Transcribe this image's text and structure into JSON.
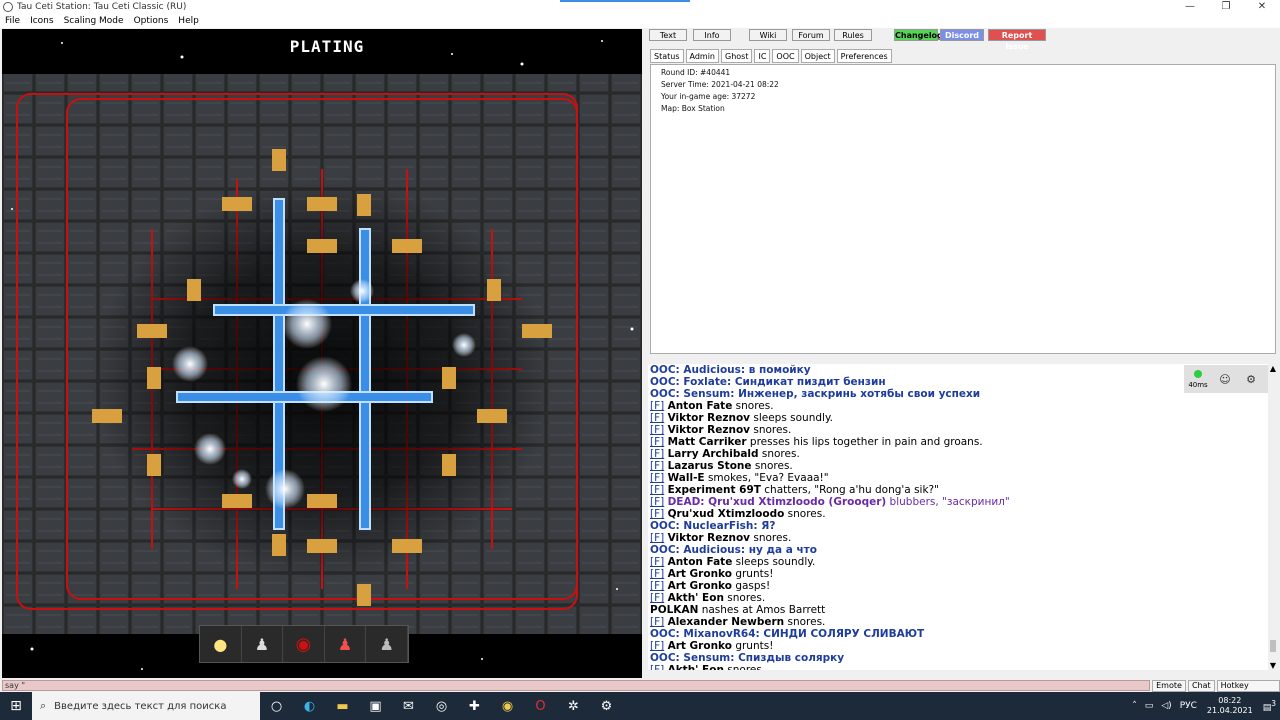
{
  "window": {
    "title": "Tau Ceti Station: Tau Ceti Classic (RU)",
    "controls": [
      "—",
      "❐",
      "✕"
    ]
  },
  "menu": [
    "File",
    "Icons",
    "Scaling Mode",
    "Options",
    "Help"
  ],
  "game": {
    "turf_name": "PLATING"
  },
  "top_buttons": {
    "text": "Text",
    "info": "Info",
    "wiki": "Wiki",
    "forum": "Forum",
    "rules": "Rules",
    "changelog": "Changelog",
    "discord": "Discord",
    "report": "Report Issue"
  },
  "tabs": [
    "Status",
    "Admin",
    "Ghost",
    "IC",
    "OOC",
    "Object",
    "Preferences"
  ],
  "status": [
    "Round ID: #40441",
    "Server Time: 2021-04-21 08:22",
    "Your in-game age: 37272",
    "Map: Box Station"
  ],
  "chat": [
    {
      "type": "ooc",
      "text": "OOC: Audicious: в помойку"
    },
    {
      "type": "ooc",
      "text": "OOC: Foxlate: Синдикат пиздит бензин"
    },
    {
      "type": "ooc",
      "text": "OOC: Sensum: Инженер, заскринь хотябы свои успехи"
    },
    {
      "type": "f",
      "name": "Anton Fate",
      "text": "snores."
    },
    {
      "type": "f",
      "name": "Viktor Reznov",
      "text": "sleeps soundly."
    },
    {
      "type": "f",
      "name": "Viktor Reznov",
      "text": "snores."
    },
    {
      "type": "f",
      "name": "Matt Carriker",
      "text": "presses his lips together in pain and groans."
    },
    {
      "type": "f",
      "name": "Larry Archibald",
      "text": "snores."
    },
    {
      "type": "f",
      "name": "Lazarus Stone",
      "text": "snores."
    },
    {
      "type": "f",
      "name": "Wall-E",
      "text": "smokes, \"Eva? Evaaa!\""
    },
    {
      "type": "f",
      "name": "Experiment 69T",
      "text": "chatters, \"Rong a'hu dong'a sik?\""
    },
    {
      "type": "dead",
      "name": "DEAD: Qru'xud Xtimzloodo (Grooqer)",
      "text": "blubbers, \"заскринил\""
    },
    {
      "type": "f",
      "name": "Qru'xud Xtimzloodo",
      "text": "snores."
    },
    {
      "type": "ooc",
      "text": "OOC: NuclearFish: Я?"
    },
    {
      "type": "f",
      "name": "Viktor Reznov",
      "text": "snores."
    },
    {
      "type": "ooc",
      "text": "OOC: Audicious: ну да а что"
    },
    {
      "type": "f",
      "name": "Anton Fate",
      "text": "sleeps soundly."
    },
    {
      "type": "f",
      "name": "Art Gronko",
      "text": "grunts!"
    },
    {
      "type": "f",
      "name": "Art Gronko",
      "text": "gasps!"
    },
    {
      "type": "f",
      "name": "Akth' Eon",
      "text": "snores."
    },
    {
      "type": "plain",
      "name": "POLKAN",
      "text": "nashes at Amos Barrett"
    },
    {
      "type": "f",
      "name": "Alexander Newbern",
      "text": "snores."
    },
    {
      "type": "ooc",
      "text": "OOC: MixanovR64: СИНДИ СОЛЯРУ СЛИВАЮТ"
    },
    {
      "type": "f",
      "name": "Art Gronko",
      "text": "grunts!"
    },
    {
      "type": "ooc",
      "text": "OOC: Sensum: Спиздыв солярку"
    },
    {
      "type": "f",
      "name": "Akth' Eon",
      "text": "snores."
    }
  ],
  "f_link": "[F]",
  "ping": "40ms",
  "input": {
    "value": "say \"",
    "emote": "Emote",
    "chat": "Chat",
    "hotkey": "Hotkey Toggle"
  },
  "taskbar": {
    "search_placeholder": "Введите здесь текст для поиска",
    "lang": "РУС",
    "time": "08:22",
    "date": "21.04.2021",
    "notif": "3"
  },
  "colors": {
    "ooc": "#1d3c9c",
    "dead": "#6a2aa8",
    "changelog": "#55d455",
    "discord": "#7b8fe8",
    "report": "#e05050"
  }
}
